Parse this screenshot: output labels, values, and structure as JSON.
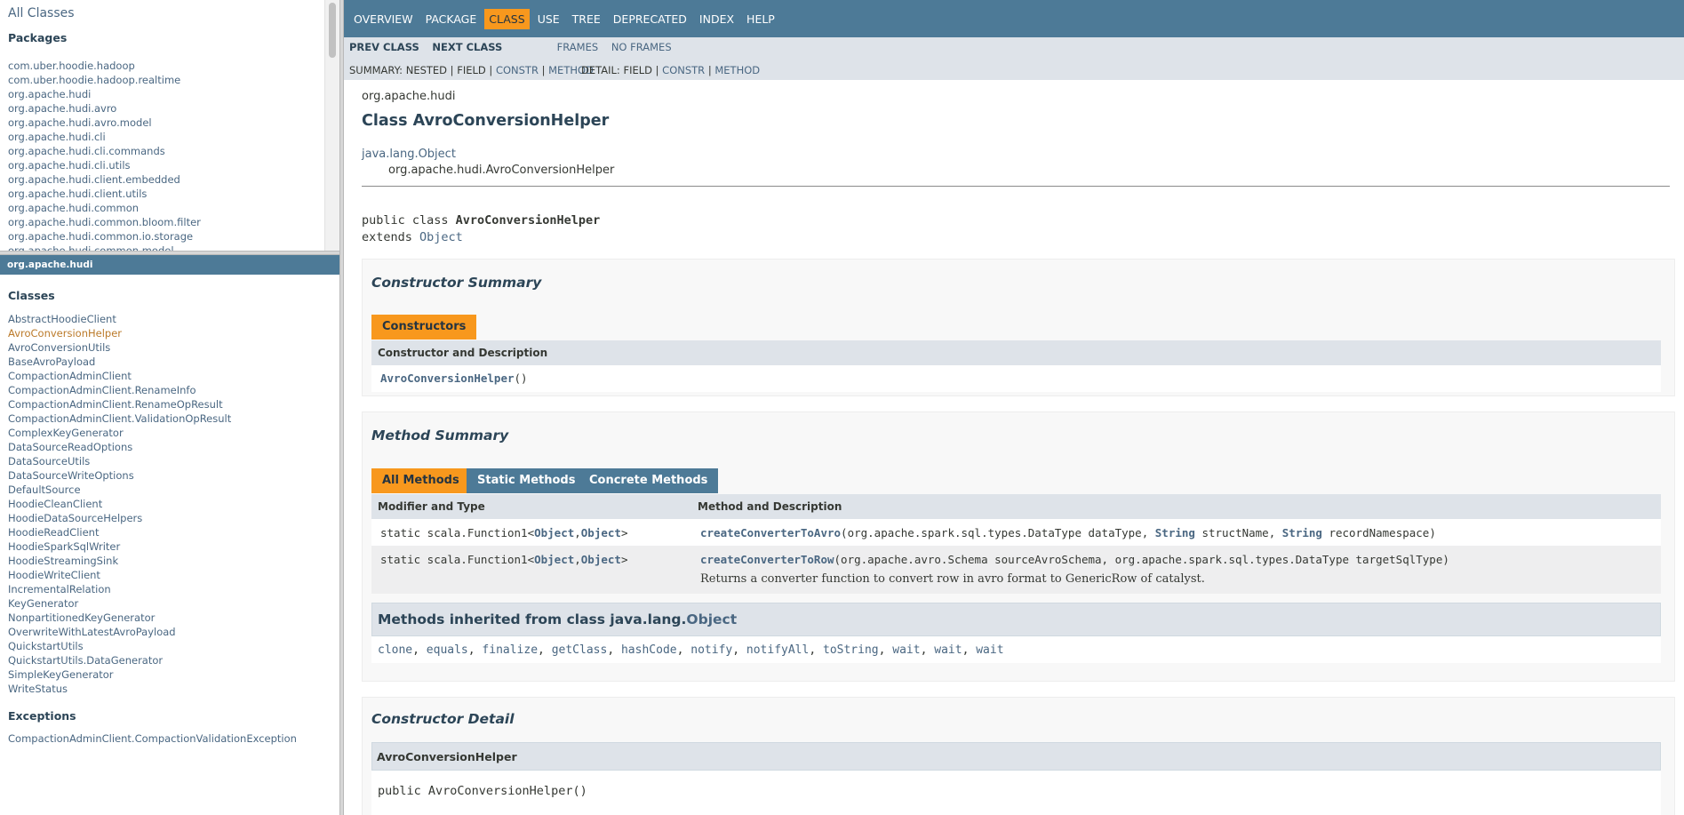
{
  "package_frame": {
    "all_classes": "All Classes",
    "heading": "Packages",
    "packages": [
      "com.uber.hoodie.hadoop",
      "com.uber.hoodie.hadoop.realtime",
      "org.apache.hudi",
      "org.apache.hudi.avro",
      "org.apache.hudi.avro.model",
      "org.apache.hudi.cli",
      "org.apache.hudi.cli.commands",
      "org.apache.hudi.cli.utils",
      "org.apache.hudi.client.embedded",
      "org.apache.hudi.client.utils",
      "org.apache.hudi.common",
      "org.apache.hudi.common.bloom.filter",
      "org.apache.hudi.common.io.storage",
      "org.apache.hudi.common.model"
    ]
  },
  "class_frame": {
    "package_bar": "org.apache.hudi",
    "classes_heading": "Classes",
    "classes": [
      "AbstractHoodieClient",
      "AvroConversionHelper",
      "AvroConversionUtils",
      "BaseAvroPayload",
      "CompactionAdminClient",
      "CompactionAdminClient.RenameInfo",
      "CompactionAdminClient.RenameOpResult",
      "CompactionAdminClient.ValidationOpResult",
      "ComplexKeyGenerator",
      "DataSourceReadOptions",
      "DataSourceUtils",
      "DataSourceWriteOptions",
      "DefaultSource",
      "HoodieCleanClient",
      "HoodieDataSourceHelpers",
      "HoodieReadClient",
      "HoodieSparkSqlWriter",
      "HoodieStreamingSink",
      "HoodieWriteClient",
      "IncrementalRelation",
      "KeyGenerator",
      "NonpartitionedKeyGenerator",
      "OverwriteWithLatestAvroPayload",
      "QuickstartUtils",
      "QuickstartUtils.DataGenerator",
      "SimpleKeyGenerator",
      "WriteStatus"
    ],
    "current_class": "AvroConversionHelper",
    "exceptions_heading": "Exceptions",
    "exceptions": [
      "CompactionAdminClient.CompactionValidationException"
    ]
  },
  "topnav": {
    "items": [
      "OVERVIEW",
      "PACKAGE",
      "CLASS",
      "USE",
      "TREE",
      "DEPRECATED",
      "INDEX",
      "HELP"
    ],
    "active": "CLASS"
  },
  "subnav": {
    "prev": "PREV CLASS",
    "next": "NEXT CLASS",
    "frames": "FRAMES",
    "noframes": "NO FRAMES",
    "summary_prefix": "SUMMARY: NESTED | FIELD | ",
    "summary_constr": "CONSTR",
    "summary_sep": " | ",
    "summary_method": "METHOD",
    "detail_prefix": "DETAIL: FIELD | ",
    "detail_constr": "CONSTR",
    "detail_sep": " | ",
    "detail_method": "METHOD"
  },
  "header": {
    "package": "org.apache.hudi",
    "title": "Class AvroConversionHelper",
    "super": "java.lang.Object",
    "this": "org.apache.hudi.AvroConversionHelper",
    "decl_prefix": "public class ",
    "decl_name": "AvroConversionHelper",
    "decl_extends": "extends ",
    "decl_object": "Object"
  },
  "constructor_summary": {
    "heading": "Constructor Summary",
    "tab": "Constructors",
    "col1": "Constructor and Description",
    "ctor_name": "AvroConversionHelper",
    "ctor_args": "()"
  },
  "method_summary": {
    "heading": "Method Summary",
    "tabs": [
      "All Methods",
      "Static Methods",
      "Concrete Methods"
    ],
    "col1": "Modifier and Type",
    "col2": "Method and Description",
    "rows": [
      {
        "type_prefix": "static scala.Function1<",
        "type_a": "Object",
        "type_comma": ",",
        "type_b": "Object",
        "type_suffix": ">",
        "name": "createConverterToAvro",
        "sig_1": "(org.apache.spark.sql.types.DataType dataType, ",
        "sig_t1": "String",
        "sig_2": " structName, ",
        "sig_t2": "String",
        "sig_3": " recordNamespace)",
        "desc": ""
      },
      {
        "type_prefix": "static scala.Function1<",
        "type_a": "Object",
        "type_comma": ",",
        "type_b": "Object",
        "type_suffix": ">",
        "name": "createConverterToRow",
        "sig_1": "(org.apache.avro.Schema sourceAvroSchema, org.apache.spark.sql.types.DataType targetSqlType)",
        "sig_t1": "",
        "sig_2": "",
        "sig_t2": "",
        "sig_3": "",
        "desc": "Returns a converter function to convert row in avro format to GenericRow of catalyst."
      }
    ],
    "inherited_prefix": "Methods inherited from class java.lang.",
    "inherited_class": "Object",
    "inherited_methods": [
      "clone",
      "equals",
      "finalize",
      "getClass",
      "hashCode",
      "notify",
      "notifyAll",
      "toString",
      "wait",
      "wait",
      "wait"
    ]
  },
  "constructor_detail": {
    "heading": "Constructor Detail",
    "name": "AvroConversionHelper",
    "signature": "public AvroConversionHelper()"
  },
  "colors": {
    "nav_bg": "#4D7A97",
    "active_tab": "#F8981D",
    "subnav_bg": "#dee3e9",
    "link": "#4A6782"
  }
}
